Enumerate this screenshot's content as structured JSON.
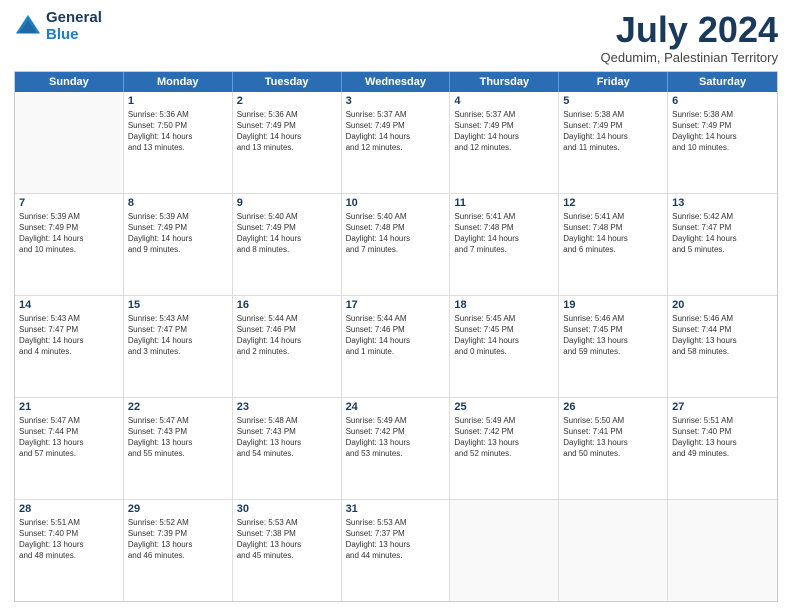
{
  "logo": {
    "line1": "General",
    "line2": "Blue"
  },
  "title": "July 2024",
  "subtitle": "Qedumim, Palestinian Territory",
  "header_days": [
    "Sunday",
    "Monday",
    "Tuesday",
    "Wednesday",
    "Thursday",
    "Friday",
    "Saturday"
  ],
  "weeks": [
    [
      {
        "day": "",
        "lines": []
      },
      {
        "day": "1",
        "lines": [
          "Sunrise: 5:36 AM",
          "Sunset: 7:50 PM",
          "Daylight: 14 hours",
          "and 13 minutes."
        ]
      },
      {
        "day": "2",
        "lines": [
          "Sunrise: 5:36 AM",
          "Sunset: 7:49 PM",
          "Daylight: 14 hours",
          "and 13 minutes."
        ]
      },
      {
        "day": "3",
        "lines": [
          "Sunrise: 5:37 AM",
          "Sunset: 7:49 PM",
          "Daylight: 14 hours",
          "and 12 minutes."
        ]
      },
      {
        "day": "4",
        "lines": [
          "Sunrise: 5:37 AM",
          "Sunset: 7:49 PM",
          "Daylight: 14 hours",
          "and 12 minutes."
        ]
      },
      {
        "day": "5",
        "lines": [
          "Sunrise: 5:38 AM",
          "Sunset: 7:49 PM",
          "Daylight: 14 hours",
          "and 11 minutes."
        ]
      },
      {
        "day": "6",
        "lines": [
          "Sunrise: 5:38 AM",
          "Sunset: 7:49 PM",
          "Daylight: 14 hours",
          "and 10 minutes."
        ]
      }
    ],
    [
      {
        "day": "7",
        "lines": [
          "Sunrise: 5:39 AM",
          "Sunset: 7:49 PM",
          "Daylight: 14 hours",
          "and 10 minutes."
        ]
      },
      {
        "day": "8",
        "lines": [
          "Sunrise: 5:39 AM",
          "Sunset: 7:49 PM",
          "Daylight: 14 hours",
          "and 9 minutes."
        ]
      },
      {
        "day": "9",
        "lines": [
          "Sunrise: 5:40 AM",
          "Sunset: 7:49 PM",
          "Daylight: 14 hours",
          "and 8 minutes."
        ]
      },
      {
        "day": "10",
        "lines": [
          "Sunrise: 5:40 AM",
          "Sunset: 7:48 PM",
          "Daylight: 14 hours",
          "and 7 minutes."
        ]
      },
      {
        "day": "11",
        "lines": [
          "Sunrise: 5:41 AM",
          "Sunset: 7:48 PM",
          "Daylight: 14 hours",
          "and 7 minutes."
        ]
      },
      {
        "day": "12",
        "lines": [
          "Sunrise: 5:41 AM",
          "Sunset: 7:48 PM",
          "Daylight: 14 hours",
          "and 6 minutes."
        ]
      },
      {
        "day": "13",
        "lines": [
          "Sunrise: 5:42 AM",
          "Sunset: 7:47 PM",
          "Daylight: 14 hours",
          "and 5 minutes."
        ]
      }
    ],
    [
      {
        "day": "14",
        "lines": [
          "Sunrise: 5:43 AM",
          "Sunset: 7:47 PM",
          "Daylight: 14 hours",
          "and 4 minutes."
        ]
      },
      {
        "day": "15",
        "lines": [
          "Sunrise: 5:43 AM",
          "Sunset: 7:47 PM",
          "Daylight: 14 hours",
          "and 3 minutes."
        ]
      },
      {
        "day": "16",
        "lines": [
          "Sunrise: 5:44 AM",
          "Sunset: 7:46 PM",
          "Daylight: 14 hours",
          "and 2 minutes."
        ]
      },
      {
        "day": "17",
        "lines": [
          "Sunrise: 5:44 AM",
          "Sunset: 7:46 PM",
          "Daylight: 14 hours",
          "and 1 minute."
        ]
      },
      {
        "day": "18",
        "lines": [
          "Sunrise: 5:45 AM",
          "Sunset: 7:45 PM",
          "Daylight: 14 hours",
          "and 0 minutes."
        ]
      },
      {
        "day": "19",
        "lines": [
          "Sunrise: 5:46 AM",
          "Sunset: 7:45 PM",
          "Daylight: 13 hours",
          "and 59 minutes."
        ]
      },
      {
        "day": "20",
        "lines": [
          "Sunrise: 5:46 AM",
          "Sunset: 7:44 PM",
          "Daylight: 13 hours",
          "and 58 minutes."
        ]
      }
    ],
    [
      {
        "day": "21",
        "lines": [
          "Sunrise: 5:47 AM",
          "Sunset: 7:44 PM",
          "Daylight: 13 hours",
          "and 57 minutes."
        ]
      },
      {
        "day": "22",
        "lines": [
          "Sunrise: 5:47 AM",
          "Sunset: 7:43 PM",
          "Daylight: 13 hours",
          "and 55 minutes."
        ]
      },
      {
        "day": "23",
        "lines": [
          "Sunrise: 5:48 AM",
          "Sunset: 7:43 PM",
          "Daylight: 13 hours",
          "and 54 minutes."
        ]
      },
      {
        "day": "24",
        "lines": [
          "Sunrise: 5:49 AM",
          "Sunset: 7:42 PM",
          "Daylight: 13 hours",
          "and 53 minutes."
        ]
      },
      {
        "day": "25",
        "lines": [
          "Sunrise: 5:49 AM",
          "Sunset: 7:42 PM",
          "Daylight: 13 hours",
          "and 52 minutes."
        ]
      },
      {
        "day": "26",
        "lines": [
          "Sunrise: 5:50 AM",
          "Sunset: 7:41 PM",
          "Daylight: 13 hours",
          "and 50 minutes."
        ]
      },
      {
        "day": "27",
        "lines": [
          "Sunrise: 5:51 AM",
          "Sunset: 7:40 PM",
          "Daylight: 13 hours",
          "and 49 minutes."
        ]
      }
    ],
    [
      {
        "day": "28",
        "lines": [
          "Sunrise: 5:51 AM",
          "Sunset: 7:40 PM",
          "Daylight: 13 hours",
          "and 48 minutes."
        ]
      },
      {
        "day": "29",
        "lines": [
          "Sunrise: 5:52 AM",
          "Sunset: 7:39 PM",
          "Daylight: 13 hours",
          "and 46 minutes."
        ]
      },
      {
        "day": "30",
        "lines": [
          "Sunrise: 5:53 AM",
          "Sunset: 7:38 PM",
          "Daylight: 13 hours",
          "and 45 minutes."
        ]
      },
      {
        "day": "31",
        "lines": [
          "Sunrise: 5:53 AM",
          "Sunset: 7:37 PM",
          "Daylight: 13 hours",
          "and 44 minutes."
        ]
      },
      {
        "day": "",
        "lines": []
      },
      {
        "day": "",
        "lines": []
      },
      {
        "day": "",
        "lines": []
      }
    ]
  ]
}
